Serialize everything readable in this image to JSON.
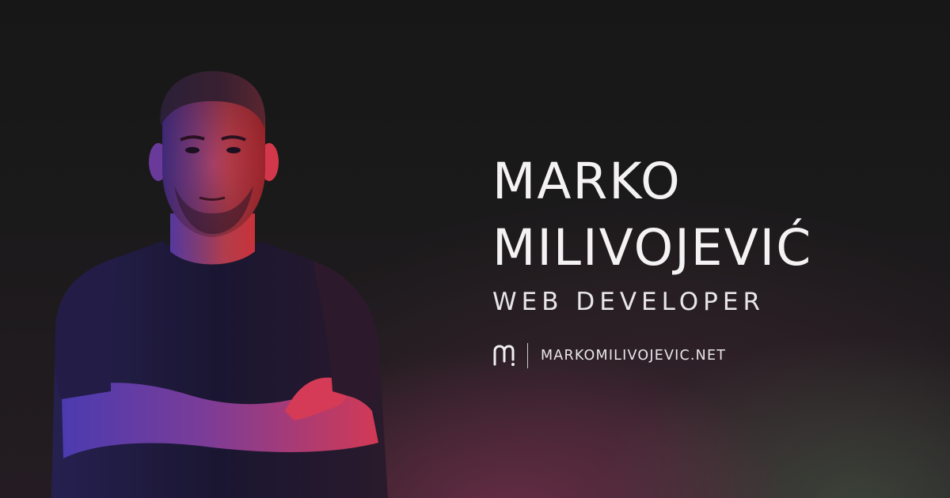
{
  "profile": {
    "first_name": "MARKO",
    "last_name": "MILIVOJEVIĆ",
    "role": "WEB DEVELOPER"
  },
  "site": {
    "logo_icon": "m-monogram-logo-icon",
    "divider": "|",
    "url": "MARKOMILIVOJEVIC.NET"
  },
  "colors": {
    "text": "#f4f2f3",
    "background": "#171717",
    "rim_light_red": "#e0314a",
    "rim_light_blue": "#4a55e0"
  }
}
